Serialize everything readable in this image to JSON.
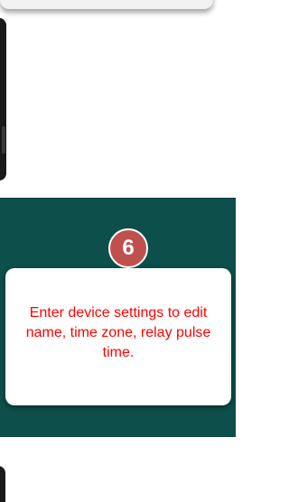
{
  "step": {
    "number": "6",
    "instruction": "Enter device settings to edit name, time zone, relay pulse time."
  },
  "colors": {
    "band": "#0d4f4a",
    "badge": "#c0504d",
    "text": "#ff0000"
  }
}
